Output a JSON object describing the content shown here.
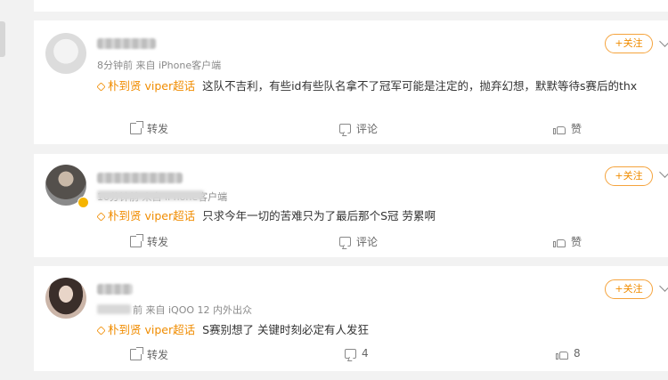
{
  "comments": [
    {
      "time": "8分钟前",
      "source": "来自 iPhone客户端",
      "topic": "朴到贤 viper超话",
      "text": "这队不吉利，有些id有些队名拿不了冠军可能是注定的，抛弃幻想，默默等待s赛后的thx",
      "follow_label": "+关注",
      "share_label": "转发",
      "comment_label": "评论",
      "like_label": "赞"
    },
    {
      "time": "10分钟前",
      "source": "来自 iPhone客户端",
      "topic": "朴到贤 viper超话",
      "text": "只求今年一切的苦难只为了最后那个S冠 劳累啊",
      "follow_label": "+关注",
      "share_label": "转发",
      "comment_label": "评论",
      "like_label": "赞"
    },
    {
      "time": "前",
      "source": "来自 iQOO 12 内外出众",
      "topic": "朴到贤 viper超话",
      "text": "S赛别想了 关键时刻必定有人发狂",
      "follow_label": "+关注",
      "share_label": "转发",
      "comment_label": "4",
      "like_label": "8"
    }
  ],
  "icons": {
    "share": "share-icon",
    "comment": "comment-icon",
    "like": "thumbs-up-icon",
    "topic": "super-topic-icon",
    "more": "chevron-down-icon"
  },
  "colors": {
    "accent": "#f08c00",
    "follow_border": "#f5a33c"
  }
}
